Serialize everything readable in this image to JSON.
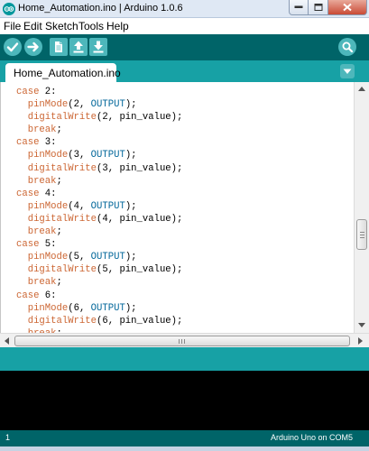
{
  "window": {
    "title": "Home_Automation.ino | Arduino 1.0.6",
    "app_icon": "arduino-logo-icon",
    "controls": [
      "minimize-icon",
      "maximize-icon",
      "close-icon"
    ]
  },
  "menu": {
    "items": [
      {
        "label": "File"
      },
      {
        "label": "Edit"
      },
      {
        "label": "Sketch"
      },
      {
        "label": "Tools"
      },
      {
        "label": "Help"
      }
    ]
  },
  "toolbar": {
    "buttons": [
      {
        "icon": "verify-checkmark-icon"
      },
      {
        "icon": "upload-arrow-icon"
      },
      {
        "icon": "new-document-icon"
      },
      {
        "icon": "open-up-arrow-icon"
      },
      {
        "icon": "save-down-arrow-icon"
      }
    ],
    "serial_monitor_icon": "magnifier-icon"
  },
  "tabs": {
    "items": [
      {
        "label": "Home_Automation.ino",
        "active": true
      }
    ],
    "menu_icon": "triangle-down-icon"
  },
  "editor": {
    "lines": [
      [
        {
          "t": "case",
          "c": "kw"
        },
        {
          "t": " 2:"
        }
      ],
      [
        {
          "t": "  "
        },
        {
          "t": "pinMode",
          "c": "fn"
        },
        {
          "t": "(2, "
        },
        {
          "t": "OUTPUT",
          "c": "const"
        },
        {
          "t": ");"
        }
      ],
      [
        {
          "t": "  "
        },
        {
          "t": "digitalWrite",
          "c": "fn"
        },
        {
          "t": "(2, pin_value);"
        }
      ],
      [
        {
          "t": "  "
        },
        {
          "t": "break",
          "c": "kw"
        },
        {
          "t": ";"
        }
      ],
      [
        {
          "t": "case",
          "c": "kw"
        },
        {
          "t": " 3:"
        }
      ],
      [
        {
          "t": "  "
        },
        {
          "t": "pinMode",
          "c": "fn"
        },
        {
          "t": "(3, "
        },
        {
          "t": "OUTPUT",
          "c": "const"
        },
        {
          "t": ");"
        }
      ],
      [
        {
          "t": "  "
        },
        {
          "t": "digitalWrite",
          "c": "fn"
        },
        {
          "t": "(3, pin_value);"
        }
      ],
      [
        {
          "t": "  "
        },
        {
          "t": "break",
          "c": "kw"
        },
        {
          "t": ";"
        }
      ],
      [
        {
          "t": "case",
          "c": "kw"
        },
        {
          "t": " 4:"
        }
      ],
      [
        {
          "t": "  "
        },
        {
          "t": "pinMode",
          "c": "fn"
        },
        {
          "t": "(4, "
        },
        {
          "t": "OUTPUT",
          "c": "const"
        },
        {
          "t": ");"
        }
      ],
      [
        {
          "t": "  "
        },
        {
          "t": "digitalWrite",
          "c": "fn"
        },
        {
          "t": "(4, pin_value);"
        }
      ],
      [
        {
          "t": "  "
        },
        {
          "t": "break",
          "c": "kw"
        },
        {
          "t": ";"
        }
      ],
      [
        {
          "t": "case",
          "c": "kw"
        },
        {
          "t": " 5:"
        }
      ],
      [
        {
          "t": "  "
        },
        {
          "t": "pinMode",
          "c": "fn"
        },
        {
          "t": "(5, "
        },
        {
          "t": "OUTPUT",
          "c": "const"
        },
        {
          "t": ");"
        }
      ],
      [
        {
          "t": "  "
        },
        {
          "t": "digitalWrite",
          "c": "fn"
        },
        {
          "t": "(5, pin_value);"
        }
      ],
      [
        {
          "t": "  "
        },
        {
          "t": "break",
          "c": "kw"
        },
        {
          "t": ";"
        }
      ],
      [
        {
          "t": "case",
          "c": "kw"
        },
        {
          "t": " 6:"
        }
      ],
      [
        {
          "t": "  "
        },
        {
          "t": "pinMode",
          "c": "fn"
        },
        {
          "t": "(6, "
        },
        {
          "t": "OUTPUT",
          "c": "const"
        },
        {
          "t": ");"
        }
      ],
      [
        {
          "t": "  "
        },
        {
          "t": "digitalWrite",
          "c": "fn"
        },
        {
          "t": "(6, pin_value);"
        }
      ],
      [
        {
          "t": "  "
        },
        {
          "t": "break",
          "c": "kw"
        },
        {
          "t": ";"
        }
      ]
    ]
  },
  "status": {
    "line_number": "1",
    "board": "Arduino Uno on COM5"
  },
  "colors": {
    "toolbar_bg": "#006468",
    "tabbar_bg": "#17a1a5",
    "button_bg": "#4db7bb",
    "keyword": "#cc6633",
    "constant": "#006699",
    "console_bg": "#000000"
  }
}
